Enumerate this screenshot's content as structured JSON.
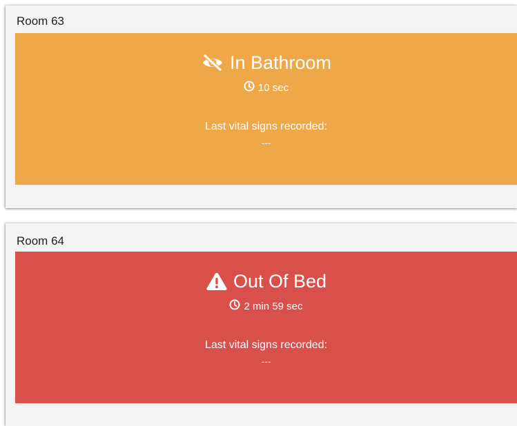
{
  "colors": {
    "bathroom_status": "#eea84a",
    "out_of_bed_status": "#d9504b",
    "card_background": "#f4f4f4",
    "text_on_status": "#ffffff"
  },
  "rooms": [
    {
      "title": "Room 63",
      "status_icon": "eye-slash-icon",
      "status": "In Bathroom",
      "timer_icon": "clock-icon",
      "timer": "10 sec",
      "vitals_label": "Last vital signs recorded:",
      "vitals_value": "---"
    },
    {
      "title": "Room 64",
      "status_icon": "warning-triangle-icon",
      "status": "Out Of Bed",
      "timer_icon": "clock-icon",
      "timer": "2 min 59 sec",
      "vitals_label": "Last vital signs recorded:",
      "vitals_value": "---"
    }
  ]
}
